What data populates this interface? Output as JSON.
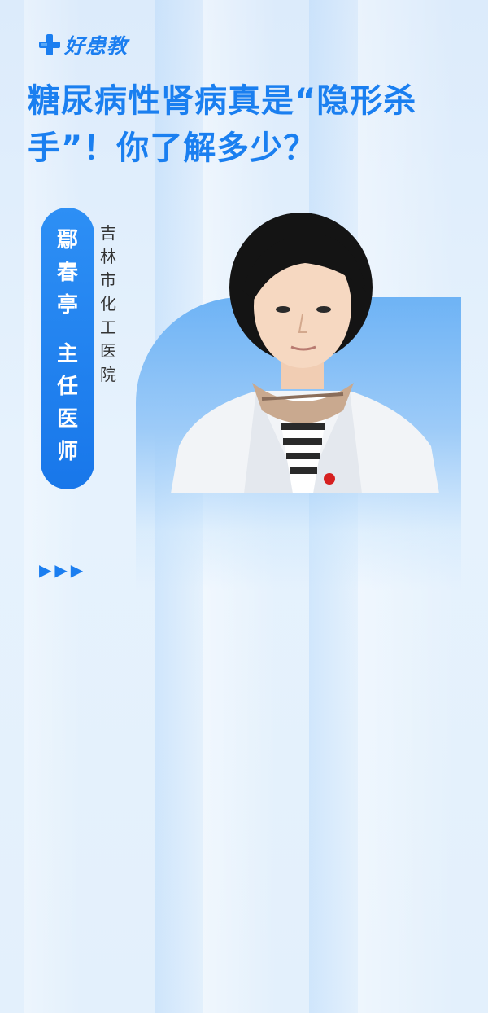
{
  "brand": {
    "name": "好患教"
  },
  "title": "糖尿病性肾病真是“隐形杀手”！你了解多少？",
  "doctor": {
    "name_chars": [
      "鄢",
      "春",
      "亭"
    ],
    "title_chars": [
      "主",
      "任",
      "医",
      "师"
    ],
    "hospital_chars": [
      "吉",
      "林",
      "市",
      "化",
      "工",
      "医",
      "院"
    ]
  },
  "arrows": "▶▶▶",
  "colors": {
    "accent": "#1b7ef0",
    "background": "#e3f0fc"
  }
}
